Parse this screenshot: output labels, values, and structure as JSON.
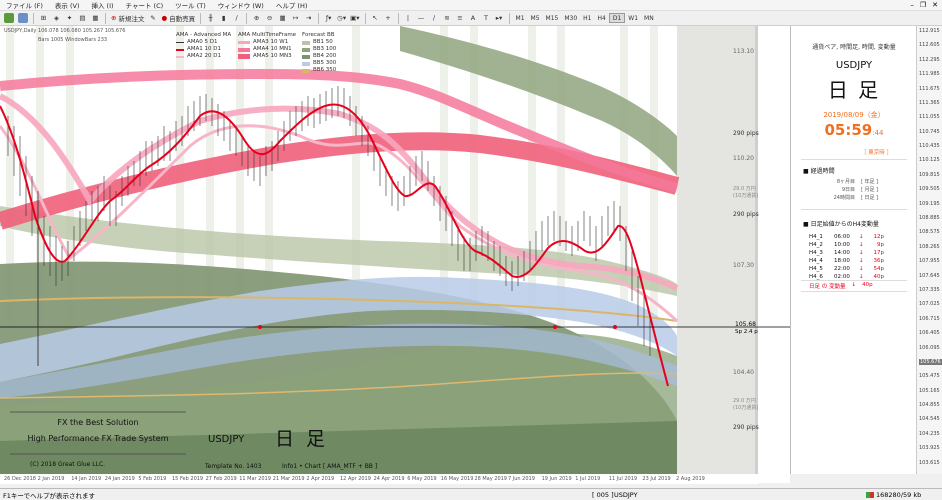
{
  "menu": [
    "ファイル (F)",
    "表示 (V)",
    "挿入 (I)",
    "チャート (C)",
    "ツール (T)",
    "ウィンドウ (W)",
    "ヘルプ (H)"
  ],
  "toolbar": {
    "new_order": "新規注文",
    "auto_trade": "自動売買",
    "timeframes": [
      "M1",
      "M5",
      "M15",
      "M30",
      "H1",
      "H4",
      "D1",
      "W1",
      "MN"
    ],
    "active_timeframe": "D1"
  },
  "chart": {
    "symbol_line": "USDJPY,Daily  106.078 106.080 105.267 105.676",
    "bars_info": "Bars 1005    WindowBars 233",
    "legend_ama_title": "AMA - Advanced MA",
    "legend_ama": [
      "AMA0  5   D1",
      "AMA1  10  D1",
      "AMA2  20  D1"
    ],
    "legend_mtf_title": "AMA MultiTimeFrame",
    "legend_mtf": [
      "AMA3  10  W1",
      "AMA4  10  MN1",
      "AMA5  10  MN3"
    ],
    "legend_bb_title": "Forecast BB",
    "legend_bb": [
      "BB1  50",
      "BB3  100",
      "BB4  200",
      "BB5  300",
      "BB6  350"
    ],
    "current_price": "105.68",
    "spread": "Sp   2.4  p",
    "price_labels": [
      "113.10",
      "110.20",
      "107.30",
      "104.40"
    ],
    "pips_labels": [
      {
        "pips": "290 pips",
        "sub": ""
      },
      {
        "pips": "29.0 万円",
        "sub": "(10万通貨)"
      },
      {
        "pips": "290 pips",
        "sub": ""
      },
      {
        "pips": "29.0 万円",
        "sub": "(10万通貨)"
      },
      {
        "pips": "290 pips",
        "sub": ""
      }
    ],
    "right_axis_prices": [
      "112.915",
      "112.605",
      "112.295",
      "111.985",
      "111.675",
      "111.365",
      "111.055",
      "110.745",
      "110.435",
      "110.125",
      "109.815",
      "109.505",
      "109.195",
      "108.885",
      "108.575",
      "108.265",
      "107.955",
      "107.645",
      "107.335",
      "107.025",
      "106.715",
      "106.405",
      "106.095",
      "105.676",
      "105.475",
      "105.165",
      "104.855",
      "104.545",
      "104.235",
      "103.925",
      "103.615"
    ],
    "current_axis_price": "105.676",
    "dates": [
      "26 Dec 2018",
      "2 Jan 2019",
      "14 Jan 2019",
      "24 Jan 2019",
      "5 Feb 2019",
      "15 Feb 2019",
      "27 Feb 2019",
      "11 Mar 2019",
      "21 Mar 2019",
      "2 Apr 2019",
      "12 Apr 2019",
      "24 Apr 2019",
      "6 May 2019",
      "16 May 2019",
      "28 May 2019",
      "7 Jun 2019",
      "19 Jun 2019",
      "1 Jul 2019",
      "11 Jul 2019",
      "23 Jul 2019",
      "2 Aug 2019"
    ]
  },
  "footer": {
    "brand1": "FX the Best Solution",
    "brand2": "High Performance FX Trade System",
    "copyright": "(C)  2018   Great Glue LLC.",
    "symbol": "USDJPY",
    "tf_kanji": "日 足",
    "template": "Template   No. 1403",
    "info": "Info1   •  Chart  [ AMA_MTF + BB ]"
  },
  "panel": {
    "header": "通貨ペア, 時間足, 時間, 変動量",
    "symbol": "USDJPY",
    "timeframe": "日 足",
    "date": "2019/08/09（金）",
    "time": "05:59",
    "seconds": ":44",
    "session": "［ 東京時 ］",
    "elapsed_title": "■  経過時間",
    "elapsed": [
      {
        "label": "8ヶ月目",
        "bracket": "[ 年足 ]"
      },
      {
        "label": "9日目",
        "bracket": "[ 月足 ]"
      },
      {
        "label": "24時間目",
        "bracket": "[ 日足 ]"
      }
    ],
    "h4_title": "■  日足始値からのH4変動量",
    "h4_rows": [
      {
        "label": "H4_1",
        "time": "06:00",
        "arrow": "↓",
        "value": "12p"
      },
      {
        "label": "H4_2",
        "time": "10:00",
        "arrow": "↓",
        "value": "9p"
      },
      {
        "label": "H4_3",
        "time": "14:00",
        "arrow": "↓",
        "value": "17p"
      },
      {
        "label": "H4_4",
        "time": "18:00",
        "arrow": "↓",
        "value": "36p"
      },
      {
        "label": "H4_5",
        "time": "22:00",
        "arrow": "↓",
        "value": "54p"
      },
      {
        "label": "H4_6",
        "time": "02:00",
        "arrow": "↓",
        "value": "40p"
      }
    ],
    "day_change_label": "日足 の 変動量",
    "day_change_arrow": "↓",
    "day_change_value": "40p"
  },
  "status": {
    "help": "F1キーでヘルプが表示されます",
    "profile": "[ 005 ]",
    "symbol": "USDJPY",
    "traffic": "168280/59 kb"
  },
  "colors": {
    "accent_pink": "#f05a78",
    "red": "#e8001c",
    "olive": "#6f8a5e",
    "blue_band": "#9fb6e0"
  }
}
